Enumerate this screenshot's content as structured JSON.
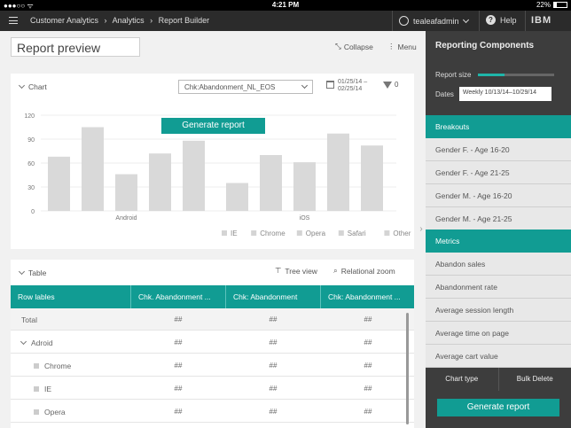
{
  "status_bar": {
    "left": "●●●○○ ᯤ",
    "time": "4:21 PM",
    "battery": "22%"
  },
  "appbar": {
    "breadcrumb": [
      "Customer Analytics",
      "›",
      "Analytics",
      "›",
      "Report Builder"
    ],
    "user": "tealeafadmin",
    "help": "Help",
    "logo": "IBM"
  },
  "main": {
    "title": "Report preview",
    "collapse": "Collapse",
    "menu": "Menu"
  },
  "chart_card": {
    "label": "Chart",
    "select_value": "Chk:Abandonment_NL_EOS",
    "date_range": [
      "01/25/14 –",
      "02/25/14"
    ],
    "filter_count": "0",
    "generate_label": "Generate report"
  },
  "chart_data": {
    "type": "bar",
    "ylim": [
      0,
      120
    ],
    "yticks": [
      "120",
      "90",
      "60",
      "30",
      "0"
    ],
    "groups": [
      "Android",
      "iOS"
    ],
    "series": [
      {
        "name": "IE",
        "values": [
          68,
          35
        ]
      },
      {
        "name": "Chrome",
        "values": [
          105,
          70
        ]
      },
      {
        "name": "Opera",
        "values": [
          46,
          61
        ]
      },
      {
        "name": "Safari",
        "values": [
          72,
          97
        ]
      },
      {
        "name": "Other",
        "values": [
          88,
          82
        ]
      }
    ],
    "bar_color": "#d9d9d9",
    "legend_position": "bottom-right"
  },
  "table_card": {
    "label": "Table",
    "tree_view": "Tree view",
    "relational_zoom": "Relational zoom",
    "columns": [
      "Row lables",
      "Chk. Abandonment ...",
      "Chk: Abandonment",
      "Chk: Abandonment ..."
    ],
    "rows": [
      {
        "label": "Total",
        "values": [
          "##",
          "##",
          "##"
        ]
      },
      {
        "label": "Adroid",
        "values": [
          "##",
          "##",
          "##"
        ]
      },
      {
        "label": "Chrome",
        "values": [
          "##",
          "##",
          "##"
        ]
      },
      {
        "label": "IE",
        "values": [
          "##",
          "##",
          "##"
        ]
      },
      {
        "label": "Opera",
        "values": [
          "##",
          "##",
          "##"
        ]
      }
    ]
  },
  "panel": {
    "title": "Reporting Components",
    "report_size_label": "Report size",
    "dates_label": "Dates",
    "dates_value": "Weekly 10/13/14–10/29/14",
    "breakouts_label": "Breakouts",
    "breakouts": [
      "Gender F. - Age 16-20",
      "Gender F. - Age 21-25",
      "Gender M. - Age 16-20",
      "Gender M. - Age 21-25"
    ],
    "metrics_label": "Metrics",
    "metrics": [
      "Abandon sales",
      "Abandonment rate",
      "Average session length",
      "Average time on page",
      "Average cart value"
    ],
    "chart_type": "Chart type",
    "bulk_delete": "Bulk Delete",
    "generate_label": "Generate report"
  },
  "accent_color": "#119c93"
}
